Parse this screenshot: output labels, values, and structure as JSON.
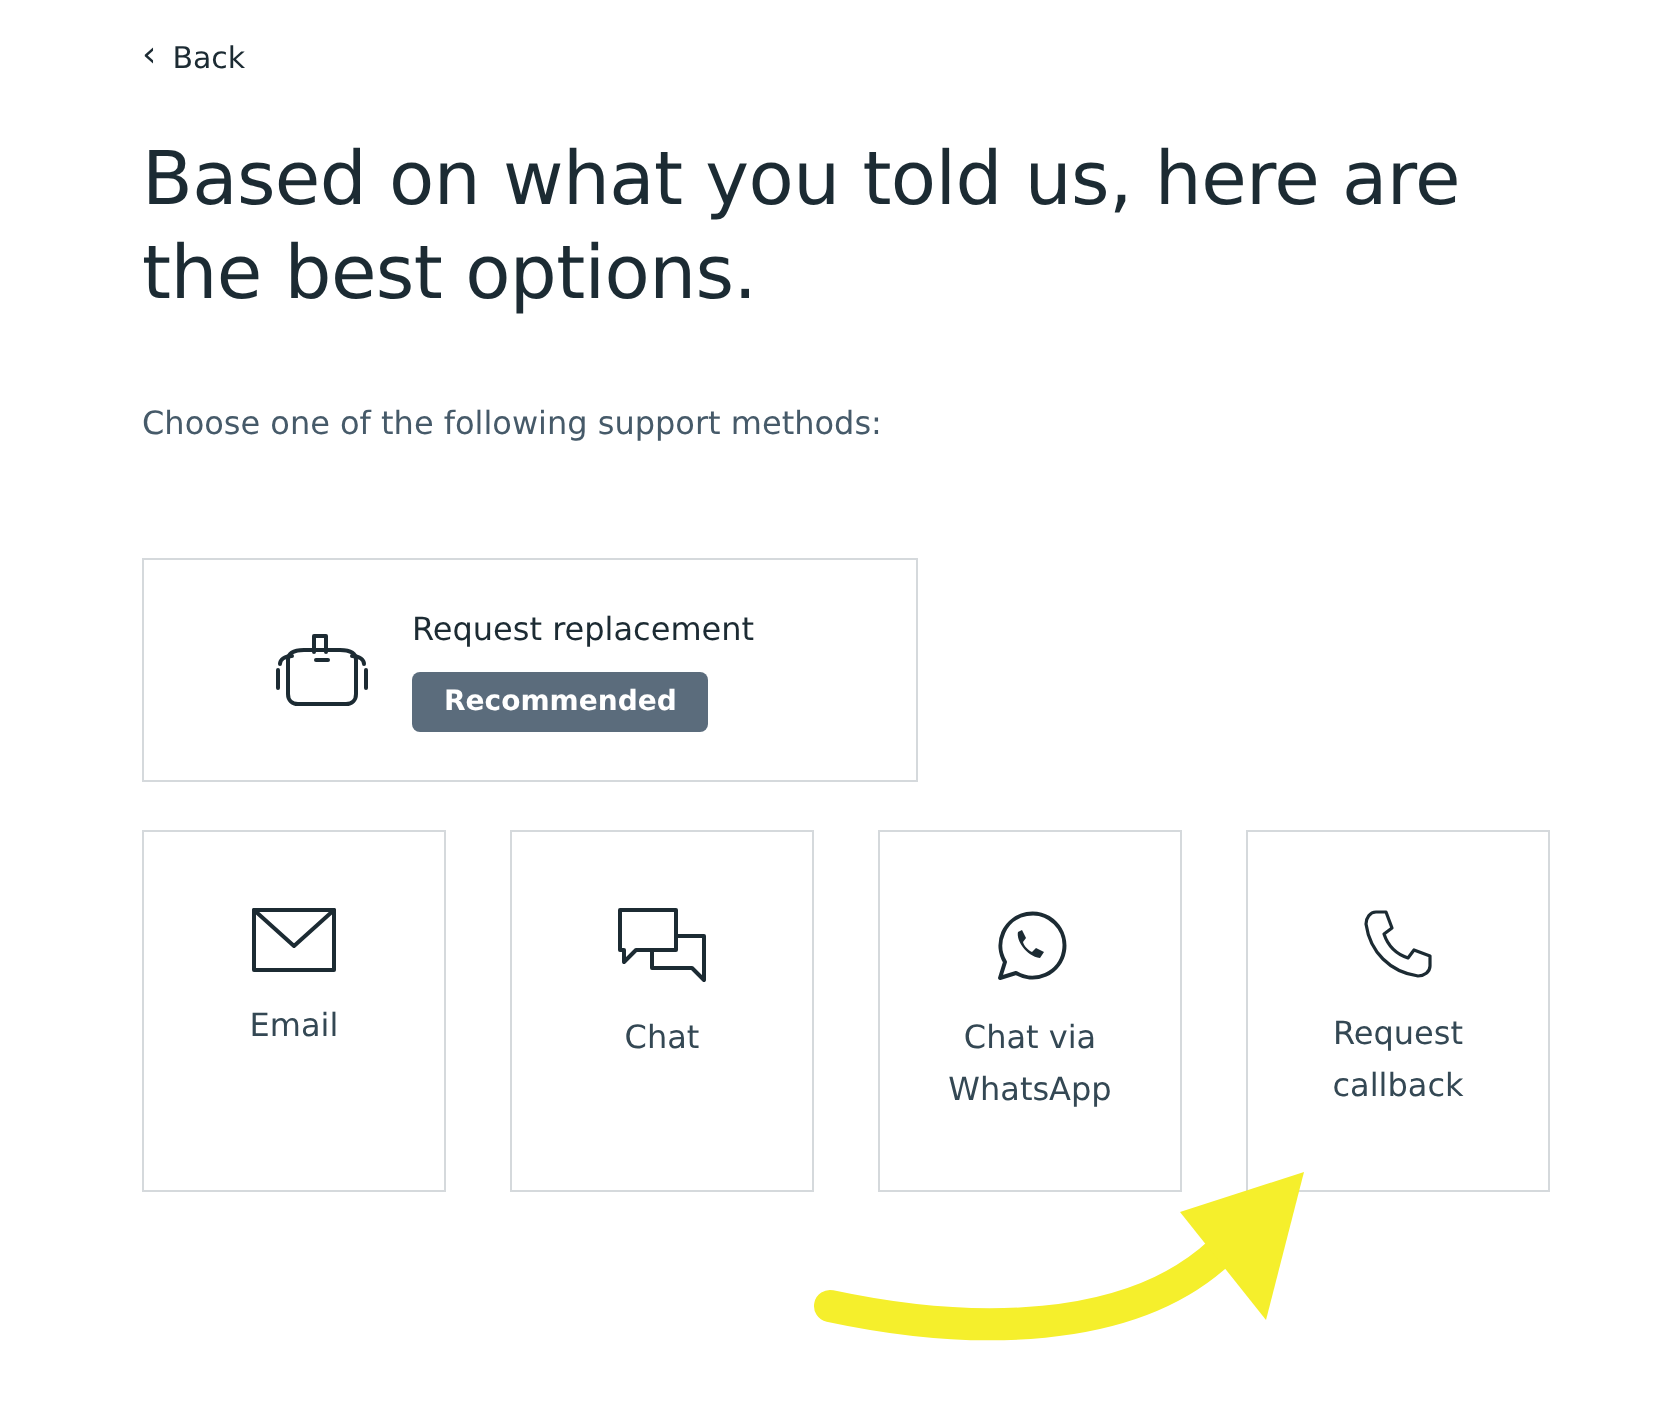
{
  "back": {
    "icon": "‹",
    "label": "Back"
  },
  "heading": "Based on what you told us, here are the best options.",
  "subtitle": "Choose one of the following support methods:",
  "featured": {
    "kind": "headset",
    "label": "Request replacement",
    "badge": "Recommended"
  },
  "options": [
    {
      "kind": "email",
      "label": "Email"
    },
    {
      "kind": "chat",
      "label": "Chat"
    },
    {
      "kind": "whatsapp",
      "label": "Chat via WhatsApp"
    },
    {
      "kind": "phone",
      "label": "Request callback"
    }
  ]
}
